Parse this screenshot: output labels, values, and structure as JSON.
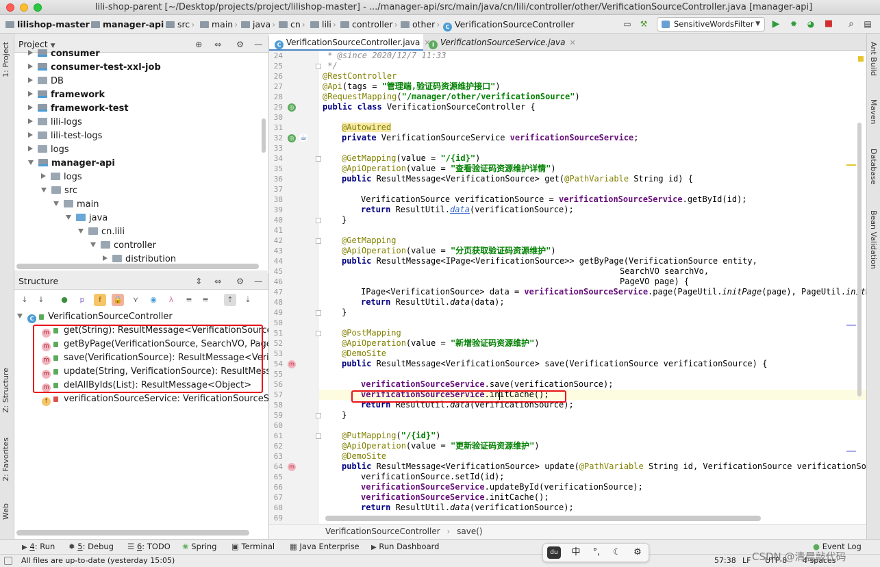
{
  "window": {
    "title": "lili-shop-parent [~/Desktop/projects/project/lilishop-master] - .../manager-api/src/main/java/cn/lili/controller/other/VerificationSourceController.java [manager-api]"
  },
  "breadcrumbs": [
    "lilishop-master",
    "manager-api",
    "src",
    "main",
    "java",
    "cn",
    "lili",
    "controller",
    "other",
    "VerificationSourceController"
  ],
  "toolbar": {
    "run_config": "SensitiveWordsFilter"
  },
  "left_strip": {
    "project": "1: Project",
    "structure": "Z: Structure",
    "favorites": "2: Favorites",
    "web": "Web"
  },
  "right_strip": {
    "ant": "Ant Build",
    "maven": "Maven",
    "database": "Database",
    "bean": "Bean Validation"
  },
  "project_panel": {
    "title": "Project",
    "items": [
      {
        "label": "consumer",
        "bold": true
      },
      {
        "label": "consumer-test-xxl-job",
        "bold": true
      },
      {
        "label": "DB",
        "bold": false
      },
      {
        "label": "framework",
        "bold": true
      },
      {
        "label": "framework-test",
        "bold": true
      },
      {
        "label": "lili-logs",
        "bold": false
      },
      {
        "label": "lili-test-logs",
        "bold": false
      },
      {
        "label": "logs",
        "bold": false
      },
      {
        "label": "manager-api",
        "bold": true
      },
      {
        "label": "logs",
        "bold": false
      },
      {
        "label": "src",
        "bold": false
      },
      {
        "label": "main",
        "bold": false
      },
      {
        "label": "java",
        "bold": false
      },
      {
        "label": "cn.lili",
        "bold": false
      },
      {
        "label": "controller",
        "bold": false
      },
      {
        "label": "distribution",
        "bold": false
      }
    ]
  },
  "structure_panel": {
    "title": "Structure",
    "root": "VerificationSourceController",
    "members": [
      {
        "label": "get(String): ResultMessage<VerificationSource>",
        "kind": "m"
      },
      {
        "label": "getByPage(VerificationSource, SearchVO, PageV",
        "kind": "m"
      },
      {
        "label": "save(VerificationSource): ResultMessage<Verific",
        "kind": "m"
      },
      {
        "label": "update(String, VerificationSource): ResultMessa",
        "kind": "m"
      },
      {
        "label": "delAllByIds(List): ResultMessage<Object>",
        "kind": "m"
      },
      {
        "label": "verificationSourceService: VerificationSourceServ",
        "kind": "f"
      }
    ]
  },
  "editor_tabs": [
    {
      "label": "VerificationSourceController.java",
      "icon": "C",
      "active": true
    },
    {
      "label": "VerificationSourceService.java",
      "icon": "I",
      "active": false
    }
  ],
  "line_numbers": [
    "24",
    "25",
    "26",
    "27",
    "28",
    "29",
    "30",
    "31",
    "32",
    "33",
    "34",
    "35",
    "36",
    "37",
    "38",
    "39",
    "40",
    "41",
    "42",
    "43",
    "44",
    "45",
    "46",
    "47",
    "48",
    "49",
    "50",
    "51",
    "52",
    "53",
    "54",
    "55",
    "56",
    "57",
    "58",
    "59",
    "60",
    "61",
    "62",
    "63",
    "64",
    "65",
    "66",
    "67",
    "68",
    "69"
  ],
  "code": {
    "l24": " * @since 2020/12/7 11:33",
    "l25": " */",
    "l26": "@RestController",
    "l27a": "@Api",
    "l27b": "(tags = ",
    "l27c": "\"管理端,验证码资源维护接口\"",
    "l27d": ")",
    "l28a": "@RequestMapping",
    "l28b": "(",
    "l28c": "\"/manager/other/verificationSource\"",
    "l28d": ")",
    "l29a": "public class ",
    "l29b": "VerificationSourceController {",
    "l31": "@Autowired",
    "l32a": "private ",
    "l32b": "VerificationSourceService ",
    "l32c": "verificationSourceService",
    "l32d": ";",
    "l34a": "@GetMapping",
    "l34b": "(value = ",
    "l34c": "\"/{id}\"",
    "l34d": ")",
    "l35a": "@ApiOperation",
    "l35b": "(value = ",
    "l35c": "\"查看验证码资源维护详情\"",
    "l35d": ")",
    "l36a": "public ",
    "l36b": "ResultMessage<VerificationSource> get(",
    "l36c": "@PathVariable",
    "l36d": " String id) {",
    "l38a": "VerificationSource verificationSource = ",
    "l38b": "verificationSourceService",
    "l38c": ".getById(id);",
    "l39a": "return ",
    "l39b": "ResultUtil.",
    "l39c": "data",
    "l39d": "(verificationSource);",
    "l40": "}",
    "l42": "@GetMapping",
    "l43a": "@ApiOperation",
    "l43b": "(value = ",
    "l43c": "\"分页获取验证码资源维护\"",
    "l43d": ")",
    "l44a": "public ",
    "l44b": "ResultMessage<IPage<VerificationSource>> getByPage(VerificationSource entity,",
    "l45": "SearchVO searchVo,",
    "l46": "PageVO page) {",
    "l47a": "IPage<VerificationSource> data = ",
    "l47b": "verificationSourceService",
    "l47c": ".page(PageUtil.",
    "l47d": "initPage",
    "l47e": "(page), PageUtil.",
    "l47f": "initWrap",
    "l48a": "return ",
    "l48b": "ResultUtil.",
    "l48c": "data",
    "l48d": "(data);",
    "l49": "}",
    "l51": "@PostMapping",
    "l52a": "@ApiOperation",
    "l52b": "(value = ",
    "l52c": "\"新增验证码资源维护\"",
    "l52d": ")",
    "l53": "@DemoSite",
    "l54a": "public ",
    "l54b": "ResultMessage<VerificationSource> save(VerificationSource verificationSource) {",
    "l56a": "verificationSourceService",
    "l56b": ".save(verificationSource);",
    "l57a": "verificationSourceService",
    "l57b": ".initCache();",
    "l58a": "return ",
    "l58b": "ResultUtil.",
    "l58c": "data",
    "l58d": "(verificationSource);",
    "l59": "}",
    "l61a": "@PutMapping",
    "l61b": "(",
    "l61c": "\"/{id}\"",
    "l61d": ")",
    "l62a": "@ApiOperation",
    "l62b": "(value = ",
    "l62c": "\"更新验证码资源维护\"",
    "l62d": ")",
    "l63": "@DemoSite",
    "l64a": "public ",
    "l64b": "ResultMessage<VerificationSource> update(",
    "l64c": "@PathVariable",
    "l64d": " String id, VerificationSource verificationSource",
    "l65": "verificationSource.setId(id);",
    "l66a": "verificationSourceService",
    "l66b": ".updateById(verificationSource);",
    "l67a": "verificationSourceService",
    "l67b": ".initCache();",
    "l68a": "return ",
    "l68b": "ResultUtil.",
    "l68c": "data",
    "l68d": "(verificationSource);"
  },
  "editor_breadcrumb": {
    "cls": "VerificationSourceController",
    "method": "save()"
  },
  "tool_windows": [
    {
      "num": "4",
      "label": ": Run"
    },
    {
      "num": "5",
      "label": ": Debug"
    },
    {
      "num": "6",
      "label": ": TODO"
    },
    {
      "num": "",
      "label": "Spring"
    },
    {
      "num": "",
      "label": "Terminal"
    },
    {
      "num": "",
      "label": "Java Enterprise"
    },
    {
      "num": "",
      "label": "Run Dashboard"
    }
  ],
  "event_log": "Event Log",
  "status": {
    "message": "All files are up-to-date (yesterday 15:05)",
    "position": "57:38",
    "line_sep": "LF",
    "encoding": "UTF-8",
    "indent": "4 spaces",
    "watermark": "CSDN @清晨敲代码"
  },
  "ime": {
    "zh": "中",
    "punct": "°,"
  },
  "colors": {
    "annotation": "#808000",
    "keyword": "#000080",
    "string": "#008000",
    "field": "#660e7a",
    "highlight_box": "#e8141a"
  }
}
